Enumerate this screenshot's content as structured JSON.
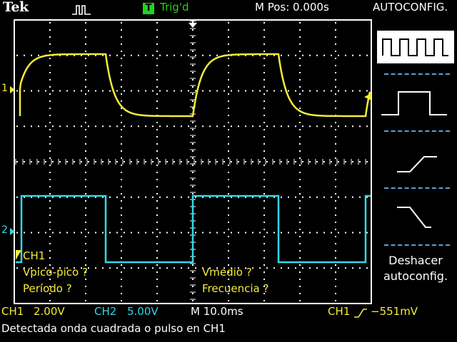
{
  "header": {
    "brand": "Tek",
    "acquisition_icon": "run-square-wave-icon",
    "trigger_badge": "T",
    "trigger_status": "Trig'd",
    "main_position": "M Pos: 0.000s",
    "menu_title": "AUTOCONFIG."
  },
  "markers": {
    "ch1": "1",
    "ch2": "2"
  },
  "menu": {
    "items": [
      {
        "icon": "square-wave-icon",
        "selected": true
      },
      {
        "icon": "single-pulse-icon",
        "selected": false
      },
      {
        "icon": "rising-edge-icon",
        "selected": false
      },
      {
        "icon": "falling-edge-icon",
        "selected": false
      }
    ],
    "undo_line1": "Deshacer",
    "undo_line2": "autoconfig."
  },
  "measurements": {
    "source": "CH1",
    "vpp": "Vpico-pico ?",
    "vmean": "Vmedio ?",
    "period": "Período ?",
    "frequency": "Frecuencia ?"
  },
  "status": {
    "ch1_label": "CH1",
    "ch1_scale": "2.00V",
    "ch2_label": "CH2",
    "ch2_scale": "5.00V",
    "timebase": "M 10.0ms",
    "trigger_source": "CH1",
    "trigger_level": "−551mV",
    "message": "Detectada onda cuadrada o pulso en CH1"
  },
  "colors": {
    "ch1": "#f5ec3a",
    "ch2": "#34d8e6",
    "trigger": "#1fd31f",
    "menu_separator": "#5a9fd6",
    "background": "#000000"
  }
}
